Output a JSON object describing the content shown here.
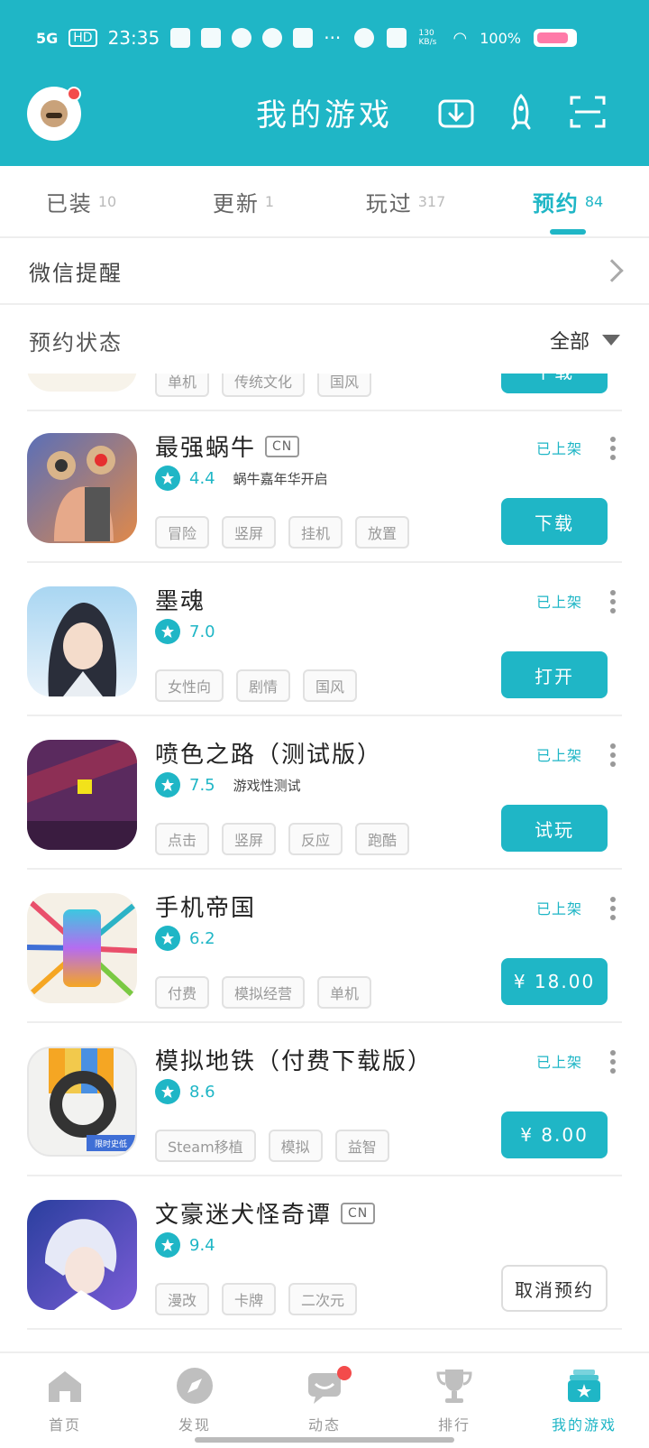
{
  "statusbar": {
    "time": "23:35",
    "signal": "5G",
    "hd": "HD",
    "battery": "100%",
    "net_speed": "130 KB/s"
  },
  "header": {
    "title": "我的游戏"
  },
  "tabs": [
    {
      "label": "已装",
      "count": "10",
      "active": false
    },
    {
      "label": "更新",
      "count": "1",
      "active": false
    },
    {
      "label": "玩过",
      "count": "317",
      "active": false
    },
    {
      "label": "预约",
      "count": "84",
      "active": true
    }
  ],
  "wechat_reminder": {
    "label": "微信提醒"
  },
  "reserve_status": {
    "label": "预约状态",
    "filter": "全部"
  },
  "partial_row": {
    "tags": [
      "单机",
      "传统文化",
      "国风"
    ],
    "button": "下载"
  },
  "games": [
    {
      "title": "最强蜗牛",
      "cn": "CN",
      "score": "4.4",
      "note": "蜗牛嘉年华开启",
      "tags": [
        "冒险",
        "竖屏",
        "挂机",
        "放置"
      ],
      "status": "已上架",
      "button": "下载",
      "outline": false
    },
    {
      "title": "墨魂",
      "cn": "",
      "score": "7.0",
      "note": "",
      "tags": [
        "女性向",
        "剧情",
        "国风"
      ],
      "status": "已上架",
      "button": "打开",
      "outline": false
    },
    {
      "title": "喷色之路（测试版）",
      "cn": "",
      "score": "7.5",
      "note": "游戏性测试",
      "tags": [
        "点击",
        "竖屏",
        "反应",
        "跑酷"
      ],
      "status": "已上架",
      "button": "试玩",
      "outline": false
    },
    {
      "title": "手机帝国",
      "cn": "",
      "score": "6.2",
      "note": "",
      "tags": [
        "付费",
        "模拟经营",
        "单机"
      ],
      "status": "已上架",
      "button": "¥ 18.00",
      "outline": false
    },
    {
      "title": "模拟地铁（付费下载版）",
      "cn": "",
      "score": "8.6",
      "note": "",
      "tags": [
        "Steam移植",
        "模拟",
        "益智"
      ],
      "status": "已上架",
      "button": "¥ 8.00",
      "outline": false
    },
    {
      "title": "文豪迷犬怪奇谭",
      "cn": "CN",
      "score": "9.4",
      "note": "",
      "tags": [
        "漫改",
        "卡牌",
        "二次元"
      ],
      "status": "",
      "button": "取消预约",
      "outline": true
    }
  ],
  "icon_badge_text": "限时史低",
  "bottom_nav": [
    {
      "label": "首页",
      "icon": "home-icon",
      "active": false,
      "dot": false
    },
    {
      "label": "发现",
      "icon": "compass-icon",
      "active": false,
      "dot": false
    },
    {
      "label": "动态",
      "icon": "chat-icon",
      "active": false,
      "dot": true
    },
    {
      "label": "排行",
      "icon": "trophy-icon",
      "active": false,
      "dot": false
    },
    {
      "label": "我的游戏",
      "icon": "my-games-icon",
      "active": true,
      "dot": false
    }
  ],
  "colors": {
    "brand": "#1fb6c6",
    "badge_red": "#f34b4b"
  }
}
